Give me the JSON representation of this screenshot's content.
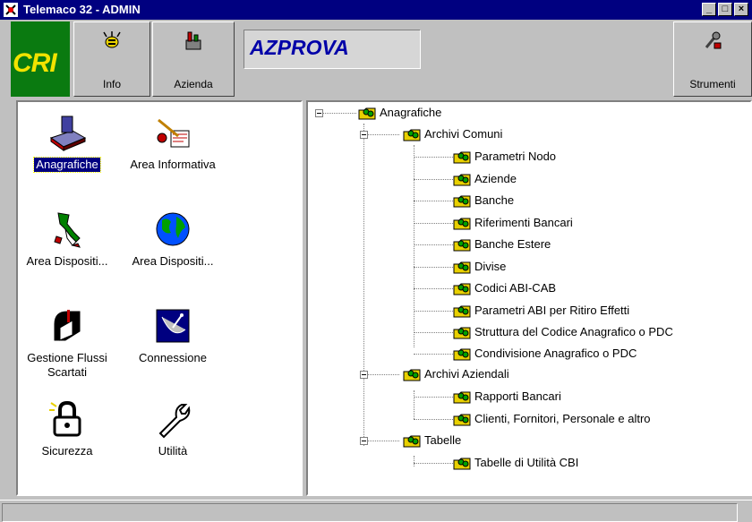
{
  "window": {
    "title": "Telemaco 32 - ADMIN"
  },
  "window_controls": {
    "minimize": "_",
    "restore": "□",
    "close": "×"
  },
  "toolbar": {
    "logo_text": "CRI",
    "info_label": "Info",
    "azienda_label": "Azienda",
    "company_code": "AZPROVA",
    "strumenti_label": "Strumenti"
  },
  "left_panel": {
    "items": [
      {
        "label": "Anagrafiche",
        "icon": "stamp-icon",
        "selected": true
      },
      {
        "label": "Area Informativa",
        "icon": "area-informativa-icon",
        "selected": false
      },
      {
        "label": "Area Dispositi...",
        "icon": "italy-map-icon",
        "selected": false
      },
      {
        "label": "Area Dispositi...",
        "icon": "globe-icon",
        "selected": false
      },
      {
        "label": "Gestione Flussi Scartati",
        "icon": "mailbox-icon",
        "selected": false
      },
      {
        "label": "Connessione",
        "icon": "satellite-dish-icon",
        "selected": false
      },
      {
        "label": "Sicurezza",
        "icon": "padlock-icon",
        "selected": false
      },
      {
        "label": "Utilità",
        "icon": "wrench-icon",
        "selected": false
      }
    ]
  },
  "tree": {
    "root": "Anagrafiche",
    "groups": [
      {
        "label": "Archivi Comuni",
        "children": [
          "Parametri Nodo",
          "Aziende",
          "Banche",
          "Riferimenti Bancari",
          "Banche Estere",
          "Divise",
          "Codici ABI-CAB",
          "Parametri ABI per Ritiro Effetti",
          "Struttura del Codice Anagrafico o PDC",
          "Condivisione Anagrafico o PDC"
        ]
      },
      {
        "label": "Archivi Aziendali",
        "children": [
          "Rapporti Bancari",
          "Clienti, Fornitori, Personale e altro"
        ]
      },
      {
        "label": "Tabelle",
        "children": [
          "Tabelle di Utilità CBI"
        ]
      }
    ]
  },
  "colors": {
    "titlebar": "#000080",
    "selection": "#000080",
    "face": "#c0c0c0",
    "company_text": "#0000a8",
    "logo_bg": "#0a7a10",
    "logo_text": "#f2e300"
  }
}
